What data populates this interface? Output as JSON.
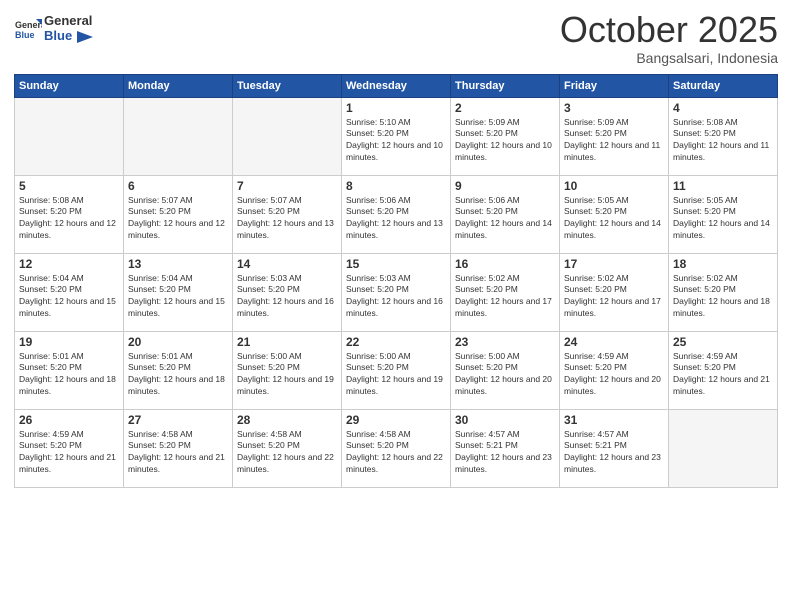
{
  "logo": {
    "text_general": "General",
    "text_blue": "Blue"
  },
  "header": {
    "month": "October 2025",
    "location": "Bangsalsari, Indonesia"
  },
  "weekdays": [
    "Sunday",
    "Monday",
    "Tuesday",
    "Wednesday",
    "Thursday",
    "Friday",
    "Saturday"
  ],
  "weeks": [
    [
      {
        "day": "",
        "sunrise": "",
        "sunset": "",
        "daylight": "",
        "empty": true
      },
      {
        "day": "",
        "sunrise": "",
        "sunset": "",
        "daylight": "",
        "empty": true
      },
      {
        "day": "",
        "sunrise": "",
        "sunset": "",
        "daylight": "",
        "empty": true
      },
      {
        "day": "1",
        "sunrise": "5:10 AM",
        "sunset": "5:20 PM",
        "daylight": "12 hours and 10 minutes."
      },
      {
        "day": "2",
        "sunrise": "5:09 AM",
        "sunset": "5:20 PM",
        "daylight": "12 hours and 10 minutes."
      },
      {
        "day": "3",
        "sunrise": "5:09 AM",
        "sunset": "5:20 PM",
        "daylight": "12 hours and 11 minutes."
      },
      {
        "day": "4",
        "sunrise": "5:08 AM",
        "sunset": "5:20 PM",
        "daylight": "12 hours and 11 minutes."
      }
    ],
    [
      {
        "day": "5",
        "sunrise": "5:08 AM",
        "sunset": "5:20 PM",
        "daylight": "12 hours and 12 minutes."
      },
      {
        "day": "6",
        "sunrise": "5:07 AM",
        "sunset": "5:20 PM",
        "daylight": "12 hours and 12 minutes."
      },
      {
        "day": "7",
        "sunrise": "5:07 AM",
        "sunset": "5:20 PM",
        "daylight": "12 hours and 13 minutes."
      },
      {
        "day": "8",
        "sunrise": "5:06 AM",
        "sunset": "5:20 PM",
        "daylight": "12 hours and 13 minutes."
      },
      {
        "day": "9",
        "sunrise": "5:06 AM",
        "sunset": "5:20 PM",
        "daylight": "12 hours and 14 minutes."
      },
      {
        "day": "10",
        "sunrise": "5:05 AM",
        "sunset": "5:20 PM",
        "daylight": "12 hours and 14 minutes."
      },
      {
        "day": "11",
        "sunrise": "5:05 AM",
        "sunset": "5:20 PM",
        "daylight": "12 hours and 14 minutes."
      }
    ],
    [
      {
        "day": "12",
        "sunrise": "5:04 AM",
        "sunset": "5:20 PM",
        "daylight": "12 hours and 15 minutes."
      },
      {
        "day": "13",
        "sunrise": "5:04 AM",
        "sunset": "5:20 PM",
        "daylight": "12 hours and 15 minutes."
      },
      {
        "day": "14",
        "sunrise": "5:03 AM",
        "sunset": "5:20 PM",
        "daylight": "12 hours and 16 minutes."
      },
      {
        "day": "15",
        "sunrise": "5:03 AM",
        "sunset": "5:20 PM",
        "daylight": "12 hours and 16 minutes."
      },
      {
        "day": "16",
        "sunrise": "5:02 AM",
        "sunset": "5:20 PM",
        "daylight": "12 hours and 17 minutes."
      },
      {
        "day": "17",
        "sunrise": "5:02 AM",
        "sunset": "5:20 PM",
        "daylight": "12 hours and 17 minutes."
      },
      {
        "day": "18",
        "sunrise": "5:02 AM",
        "sunset": "5:20 PM",
        "daylight": "12 hours and 18 minutes."
      }
    ],
    [
      {
        "day": "19",
        "sunrise": "5:01 AM",
        "sunset": "5:20 PM",
        "daylight": "12 hours and 18 minutes."
      },
      {
        "day": "20",
        "sunrise": "5:01 AM",
        "sunset": "5:20 PM",
        "daylight": "12 hours and 18 minutes."
      },
      {
        "day": "21",
        "sunrise": "5:00 AM",
        "sunset": "5:20 PM",
        "daylight": "12 hours and 19 minutes."
      },
      {
        "day": "22",
        "sunrise": "5:00 AM",
        "sunset": "5:20 PM",
        "daylight": "12 hours and 19 minutes."
      },
      {
        "day": "23",
        "sunrise": "5:00 AM",
        "sunset": "5:20 PM",
        "daylight": "12 hours and 20 minutes."
      },
      {
        "day": "24",
        "sunrise": "4:59 AM",
        "sunset": "5:20 PM",
        "daylight": "12 hours and 20 minutes."
      },
      {
        "day": "25",
        "sunrise": "4:59 AM",
        "sunset": "5:20 PM",
        "daylight": "12 hours and 21 minutes."
      }
    ],
    [
      {
        "day": "26",
        "sunrise": "4:59 AM",
        "sunset": "5:20 PM",
        "daylight": "12 hours and 21 minutes."
      },
      {
        "day": "27",
        "sunrise": "4:58 AM",
        "sunset": "5:20 PM",
        "daylight": "12 hours and 21 minutes."
      },
      {
        "day": "28",
        "sunrise": "4:58 AM",
        "sunset": "5:20 PM",
        "daylight": "12 hours and 22 minutes."
      },
      {
        "day": "29",
        "sunrise": "4:58 AM",
        "sunset": "5:20 PM",
        "daylight": "12 hours and 22 minutes."
      },
      {
        "day": "30",
        "sunrise": "4:57 AM",
        "sunset": "5:21 PM",
        "daylight": "12 hours and 23 minutes."
      },
      {
        "day": "31",
        "sunrise": "4:57 AM",
        "sunset": "5:21 PM",
        "daylight": "12 hours and 23 minutes."
      },
      {
        "day": "",
        "sunrise": "",
        "sunset": "",
        "daylight": "",
        "empty": true
      }
    ]
  ],
  "labels": {
    "sunrise": "Sunrise:",
    "sunset": "Sunset:",
    "daylight": "Daylight hours"
  }
}
